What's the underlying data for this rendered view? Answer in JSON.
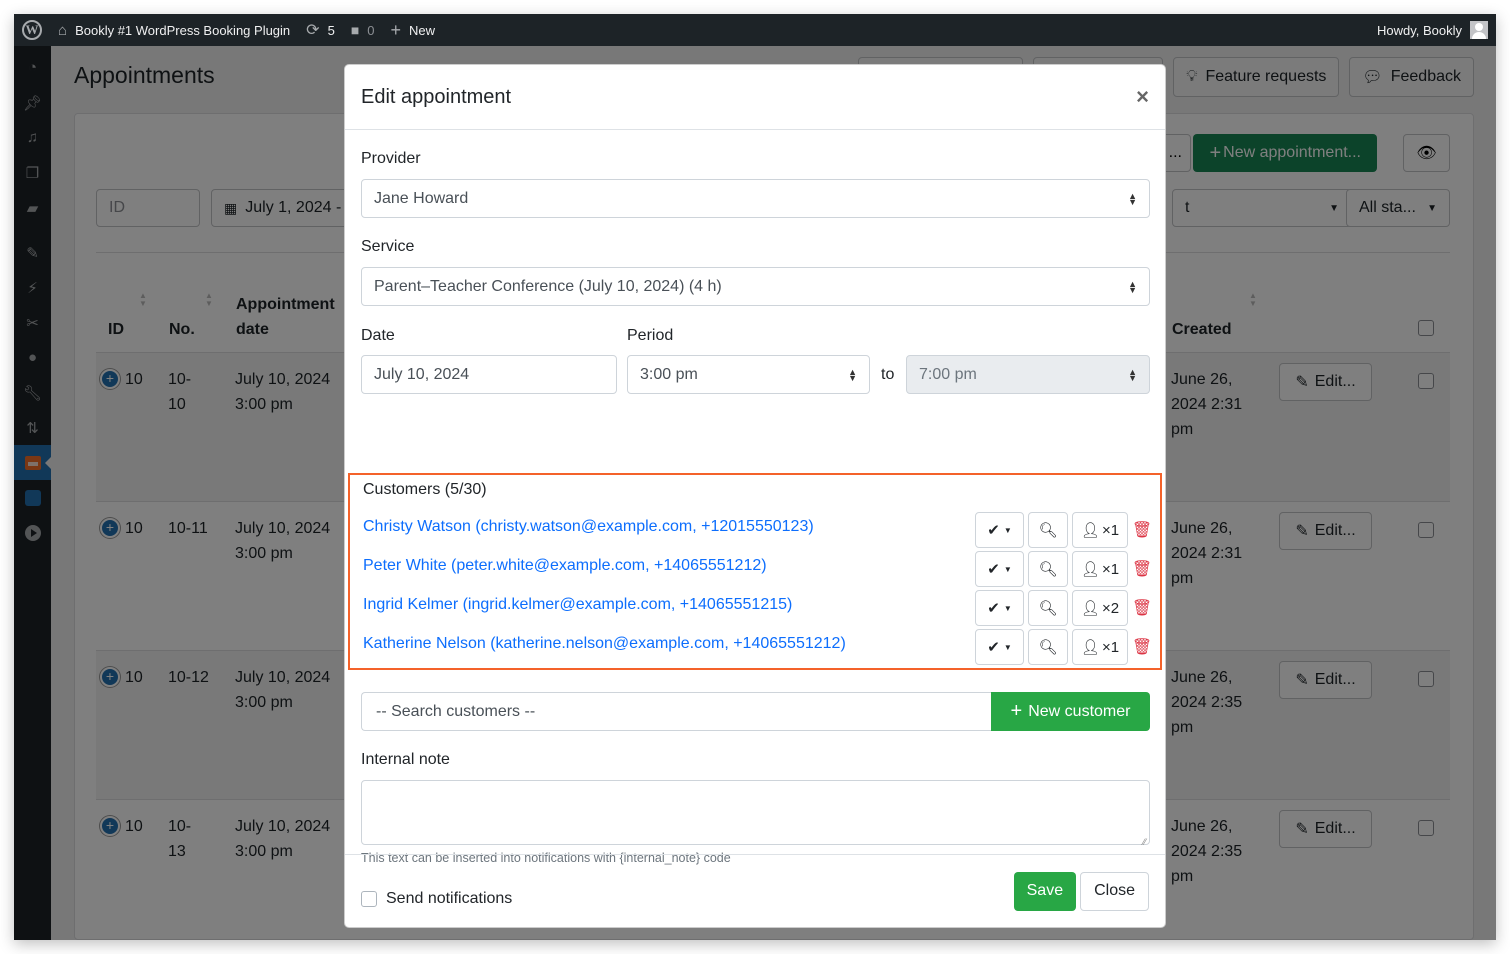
{
  "adminbar": {
    "site_name": "Bookly #1 WordPress Booking Plugin",
    "updates_count": "5",
    "comments_count": "0",
    "new_label": "New",
    "greeting": "Howdy, Bookly"
  },
  "sidebar": {
    "items": [
      "dashboard-icon",
      "posts-icon",
      "media-icon",
      "pages-icon",
      "comments-icon",
      "appearance-icon",
      "plugins-icon",
      "scissors-icon",
      "users-icon",
      "tools-icon",
      "settings-icon",
      "bookly-icon",
      "cloud-icon",
      "play-icon"
    ],
    "active": "bookly-icon"
  },
  "page": {
    "title": "Appointments",
    "top_buttons": {
      "feature_requests": "Feature requests",
      "feedback": "Feedback"
    },
    "new_appointment": "New appointment...",
    "dots_label": "...",
    "filters": {
      "id_placeholder": "ID",
      "date_range": "July 1, 2024 -",
      "service_partial": "t",
      "status": "All sta..."
    },
    "table": {
      "headers": {
        "id": "ID",
        "no": "No.",
        "appt_date": "Appointment date",
        "created": "Created"
      },
      "rows": [
        {
          "id": "10",
          "no": "10-\n10",
          "date": "July 10, 2024",
          "time": "3:00 pm",
          "created": "June 26, 2024 2:31 pm",
          "edit": "Edit..."
        },
        {
          "id": "10",
          "no": "10-11",
          "date": "July 10, 2024",
          "time": "3:00 pm",
          "created": "June 26, 2024 2:31 pm",
          "edit": "Edit..."
        },
        {
          "id": "10",
          "no": "10-12",
          "date": "July 10, 2024",
          "time": "3:00 pm",
          "created": "June 26, 2024 2:35 pm",
          "edit": "Edit..."
        },
        {
          "id": "10",
          "no": "10-\n13",
          "date": "July 10, 2024",
          "time": "3:00 pm",
          "created": "June 26, 2024 2:35 pm",
          "edit": "Edit..."
        }
      ]
    }
  },
  "modal": {
    "title": "Edit appointment",
    "provider_label": "Provider",
    "provider_value": "Jane Howard",
    "service_label": "Service",
    "service_value": "Parent–Teacher Conference (July 10, 2024) (4 h)",
    "date_label": "Date",
    "date_value": "July 10, 2024",
    "period_label": "Period",
    "period_start": "3:00 pm",
    "period_to": "to",
    "period_end": "7:00 pm",
    "customers_label": "Customers (5/30)",
    "customers": [
      {
        "text": "Christy Watson (christy.watson@example.com, +12015550123)",
        "count": "×1"
      },
      {
        "text": "Peter White (peter.white@example.com, +14065551212)",
        "count": "×1"
      },
      {
        "text": "Ingrid Kelmer (ingrid.kelmer@example.com, +14065551215)",
        "count": "×2"
      },
      {
        "text": "Katherine Nelson (katherine.nelson@example.com, +14065551212)",
        "count": "×1"
      }
    ],
    "search_placeholder": "-- Search customers --",
    "new_customer": "New customer",
    "note_label": "Internal note",
    "note_value": "",
    "note_help": "This text can be inserted into notifications with {internal_note} code",
    "send_notifications": "Send notifications",
    "send_notifications_checked": false,
    "save": "Save",
    "close": "Close"
  },
  "colors": {
    "highlight": "#f4622a",
    "link": "#0d6efd",
    "success": "#28a745",
    "danger": "#dc3545",
    "wp_dark": "#1d2327",
    "wp_blue": "#2271b1"
  }
}
